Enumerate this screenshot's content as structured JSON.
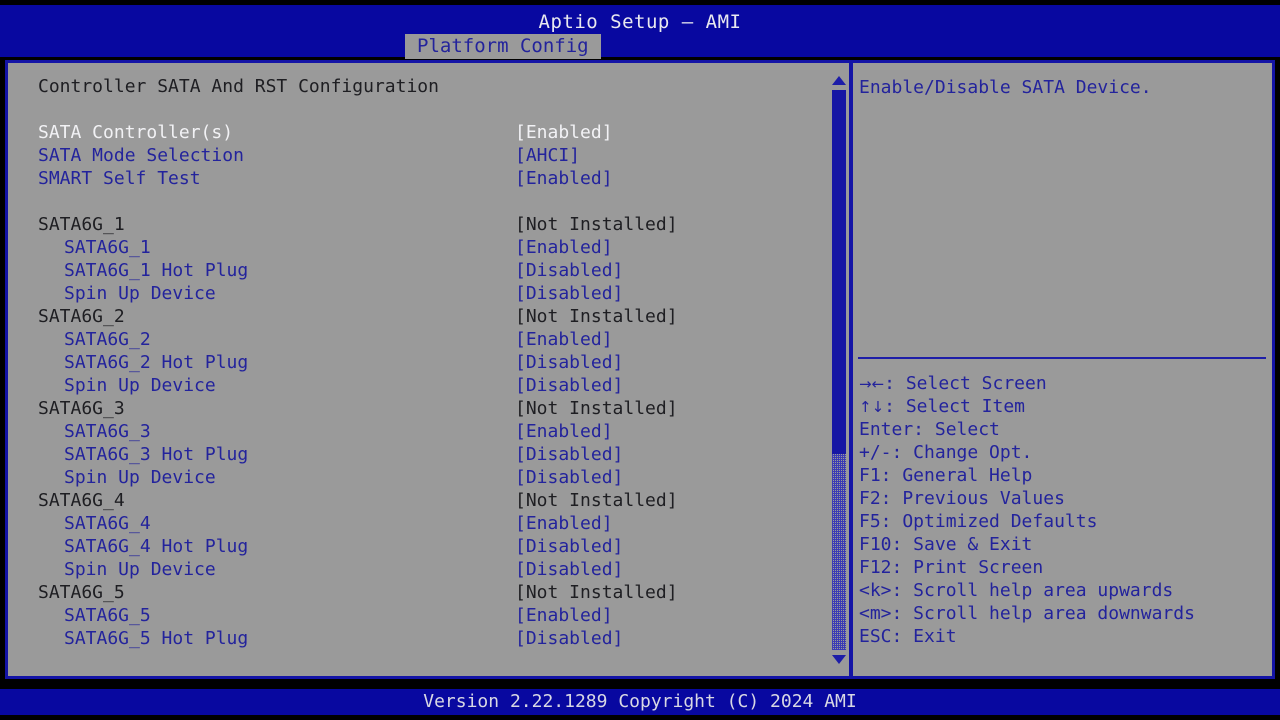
{
  "header": {
    "title": "Aptio Setup – AMI",
    "active_tab": "Platform Config"
  },
  "main": {
    "section_title": "Controller SATA And RST Configuration",
    "rows": [
      {
        "type": "heading",
        "label": "Controller SATA And RST Configuration",
        "value": "",
        "label_color": "dark",
        "value_color": "dark",
        "indent": false
      },
      {
        "type": "spacer",
        "label": "",
        "value": ""
      },
      {
        "type": "option",
        "label": "SATA Controller(s)",
        "value": "[Enabled]",
        "label_color": "white",
        "value_color": "white",
        "indent": false,
        "selected": true
      },
      {
        "type": "option",
        "label": "SATA Mode Selection",
        "value": "[AHCI]",
        "label_color": "blue",
        "value_color": "blue",
        "indent": false
      },
      {
        "type": "option",
        "label": "SMART Self Test",
        "value": "[Enabled]",
        "label_color": "blue",
        "value_color": "blue",
        "indent": false
      },
      {
        "type": "spacer",
        "label": "",
        "value": ""
      },
      {
        "type": "info",
        "label": "SATA6G_1",
        "value": "[Not Installed]",
        "label_color": "dark",
        "value_color": "dark",
        "indent": false
      },
      {
        "type": "option",
        "label": "SATA6G_1",
        "value": "[Enabled]",
        "label_color": "blue",
        "value_color": "blue",
        "indent": true
      },
      {
        "type": "option",
        "label": "SATA6G_1 Hot Plug",
        "value": "[Disabled]",
        "label_color": "blue",
        "value_color": "blue",
        "indent": true
      },
      {
        "type": "option",
        "label": "Spin Up Device",
        "value": "[Disabled]",
        "label_color": "blue",
        "value_color": "blue",
        "indent": true
      },
      {
        "type": "info",
        "label": "SATA6G_2",
        "value": "[Not Installed]",
        "label_color": "dark",
        "value_color": "dark",
        "indent": false
      },
      {
        "type": "option",
        "label": "SATA6G_2",
        "value": "[Enabled]",
        "label_color": "blue",
        "value_color": "blue",
        "indent": true
      },
      {
        "type": "option",
        "label": "SATA6G_2 Hot Plug",
        "value": "[Disabled]",
        "label_color": "blue",
        "value_color": "blue",
        "indent": true
      },
      {
        "type": "option",
        "label": "Spin Up Device",
        "value": "[Disabled]",
        "label_color": "blue",
        "value_color": "blue",
        "indent": true
      },
      {
        "type": "info",
        "label": "SATA6G_3",
        "value": "[Not Installed]",
        "label_color": "dark",
        "value_color": "dark",
        "indent": false
      },
      {
        "type": "option",
        "label": "SATA6G_3",
        "value": "[Enabled]",
        "label_color": "blue",
        "value_color": "blue",
        "indent": true
      },
      {
        "type": "option",
        "label": "SATA6G_3 Hot Plug",
        "value": "[Disabled]",
        "label_color": "blue",
        "value_color": "blue",
        "indent": true
      },
      {
        "type": "option",
        "label": "Spin Up Device",
        "value": "[Disabled]",
        "label_color": "blue",
        "value_color": "blue",
        "indent": true
      },
      {
        "type": "info",
        "label": "SATA6G_4",
        "value": "[Not Installed]",
        "label_color": "dark",
        "value_color": "dark",
        "indent": false
      },
      {
        "type": "option",
        "label": "SATA6G_4",
        "value": "[Enabled]",
        "label_color": "blue",
        "value_color": "blue",
        "indent": true
      },
      {
        "type": "option",
        "label": "SATA6G_4 Hot Plug",
        "value": "[Disabled]",
        "label_color": "blue",
        "value_color": "blue",
        "indent": true
      },
      {
        "type": "option",
        "label": "Spin Up Device",
        "value": "[Disabled]",
        "label_color": "blue",
        "value_color": "blue",
        "indent": true
      },
      {
        "type": "info",
        "label": "SATA6G_5",
        "value": "[Not Installed]",
        "label_color": "dark",
        "value_color": "dark",
        "indent": false
      },
      {
        "type": "option",
        "label": "SATA6G_5",
        "value": "[Enabled]",
        "label_color": "blue",
        "value_color": "blue",
        "indent": true
      },
      {
        "type": "option",
        "label": "SATA6G_5 Hot Plug",
        "value": "[Disabled]",
        "label_color": "blue",
        "value_color": "blue",
        "indent": true
      }
    ]
  },
  "scrollbar": {
    "up_arrow": "▲",
    "down_arrow": "▼",
    "thumb_position_pct": 0,
    "thumb_size_pct": 65
  },
  "help": {
    "description": "Enable/Disable SATA Device.",
    "legend": [
      {
        "glyph": "→←",
        "text": ": Select Screen"
      },
      {
        "glyph": "↑↓",
        "text": ": Select Item"
      },
      {
        "glyph": "",
        "text": "Enter: Select"
      },
      {
        "glyph": "",
        "text": "+/-: Change Opt."
      },
      {
        "glyph": "",
        "text": "F1: General Help"
      },
      {
        "glyph": "",
        "text": "F2: Previous Values"
      },
      {
        "glyph": "",
        "text": "F5: Optimized Defaults"
      },
      {
        "glyph": "",
        "text": "F10: Save & Exit"
      },
      {
        "glyph": "",
        "text": "F12: Print Screen"
      },
      {
        "glyph": "",
        "text": "<k>: Scroll help area upwards"
      },
      {
        "glyph": "",
        "text": "<m>: Scroll help area downwards"
      },
      {
        "glyph": "",
        "text": "ESC: Exit"
      }
    ]
  },
  "footer": {
    "version": "Version 2.22.1289 Copyright (C) 2024 AMI"
  },
  "colors": {
    "background_gray": "#9a9a9a",
    "band_blue": "#0808a0",
    "text_blue": "#23239c",
    "text_white": "#f2f2f5",
    "text_dark": "#1e1e22",
    "border_blue": "#1414a6"
  }
}
